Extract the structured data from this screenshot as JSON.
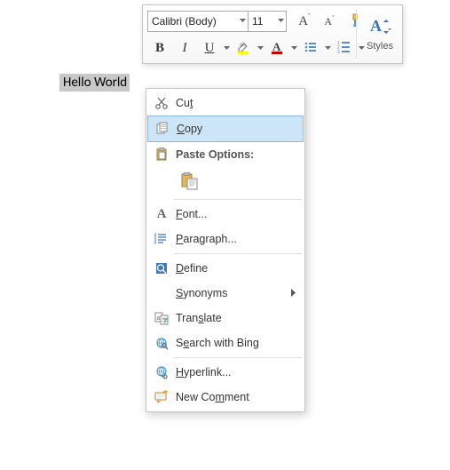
{
  "mini_toolbar": {
    "font_name": "Calibri (Body)",
    "font_size": "11",
    "b": "B",
    "i": "I",
    "u": "U",
    "styles_label": "Styles",
    "grow_font_char": "A",
    "shrink_font_char": "A"
  },
  "document": {
    "selected_text": "Hello World"
  },
  "context_menu": {
    "cut": "Cut",
    "copy": "Copy",
    "paste_options_title": "Paste Options:",
    "font": "Font...",
    "paragraph": "Paragraph...",
    "define": "Define",
    "synonyms": "Synonyms",
    "translate": "Translate",
    "search_bing": "Search with Bing",
    "hyperlink": "Hyperlink...",
    "new_comment": "New Comment",
    "font_icon_char": "A"
  }
}
